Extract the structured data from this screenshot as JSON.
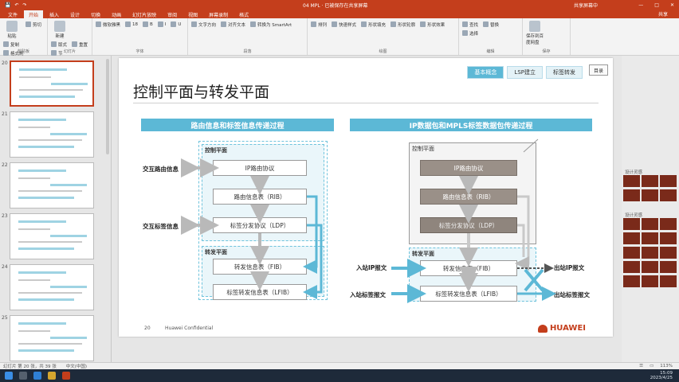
{
  "app": {
    "title": "04 MPL",
    "title_suffix": "· 已被保存在共享屏幕",
    "user": "共享屏幕中",
    "tabs": [
      "文件",
      "开始",
      "插入",
      "设计",
      "切换",
      "动画",
      "幻灯片放映",
      "审阅",
      "视图",
      "屏幕录制",
      "格式"
    ],
    "active_tab": 1,
    "share": "共享"
  },
  "ribbon": {
    "groups": [
      {
        "label": "剪贴板",
        "buttons": [
          "剪切",
          "复制",
          "格式刷"
        ],
        "big": "粘贴"
      },
      {
        "label": "幻灯片",
        "buttons": [
          "版式",
          "重置",
          "节"
        ],
        "big": "新建"
      },
      {
        "label": "字体",
        "buttons": [
          "微软雅黑",
          "18",
          "B",
          "I",
          "U"
        ]
      },
      {
        "label": "段落",
        "buttons": [
          "文字方向",
          "对齐文本",
          "转换为 SmartArt"
        ]
      },
      {
        "label": "绘图",
        "buttons": [
          "排列",
          "快速样式",
          "形状填充",
          "形状轮廓",
          "形状效果"
        ]
      },
      {
        "label": "编辑",
        "buttons": [
          "查找",
          "替换",
          "选择"
        ]
      },
      {
        "label": "保存",
        "big": "保存到百度网盘"
      }
    ]
  },
  "thumbs": [
    {
      "num": "20"
    },
    {
      "num": "21"
    },
    {
      "num": "22"
    },
    {
      "num": "23"
    },
    {
      "num": "24"
    },
    {
      "num": "25"
    }
  ],
  "slide": {
    "nav_tabs": [
      "基本概念",
      "LSP建立",
      "标签转发"
    ],
    "toc_label": "目录",
    "title": "控制平面与转发平面",
    "left": {
      "header": "路由信息和标签信息传递过程",
      "control_plane": "控制平面",
      "forward_plane": "转发平面",
      "nodes": {
        "ip_protocol": "IP路由协议",
        "rib": "路由信息表（RIB）",
        "ldp": "标签分发协议（LDP）",
        "fib": "转发信息表（FIB）",
        "lfib": "标签转发信息表（LFIB）"
      },
      "exchange_route": "交互路由信息",
      "exchange_label": "交互标签信息"
    },
    "right": {
      "header": "IP数据包和MPLS标签数据包传递过程",
      "control_plane": "控制平面",
      "forward_plane": "转发平面",
      "nodes": {
        "ip_protocol": "IP路由协议",
        "rib": "路由信息表（RIB）",
        "ldp": "标签分发协议（LDP）",
        "fib": "转发信息表（FIB）",
        "lfib": "标签转发信息表（LFIB）"
      },
      "in_ip": "入站IP报文",
      "in_label": "入站标签报文",
      "out_ip": "出站IP报文",
      "out_label": "出站标签报文"
    },
    "footer_num": "20",
    "footer_conf": "Huawei Confidential",
    "logo_text": "HUAWEI"
  },
  "design_panel": {
    "title1": "设计灵感",
    "title2": "设计灵感"
  },
  "status": {
    "slide_info": "幻灯片 第 20 张，共 39 张",
    "language": "中文(中国)",
    "zoom": "113%"
  },
  "taskbar": {
    "time": "15:09",
    "date": "2023/4/25"
  },
  "colors": {
    "accent": "#c43e1c",
    "teal": "#5cb8d6",
    "node_dark": "#9a9088"
  }
}
